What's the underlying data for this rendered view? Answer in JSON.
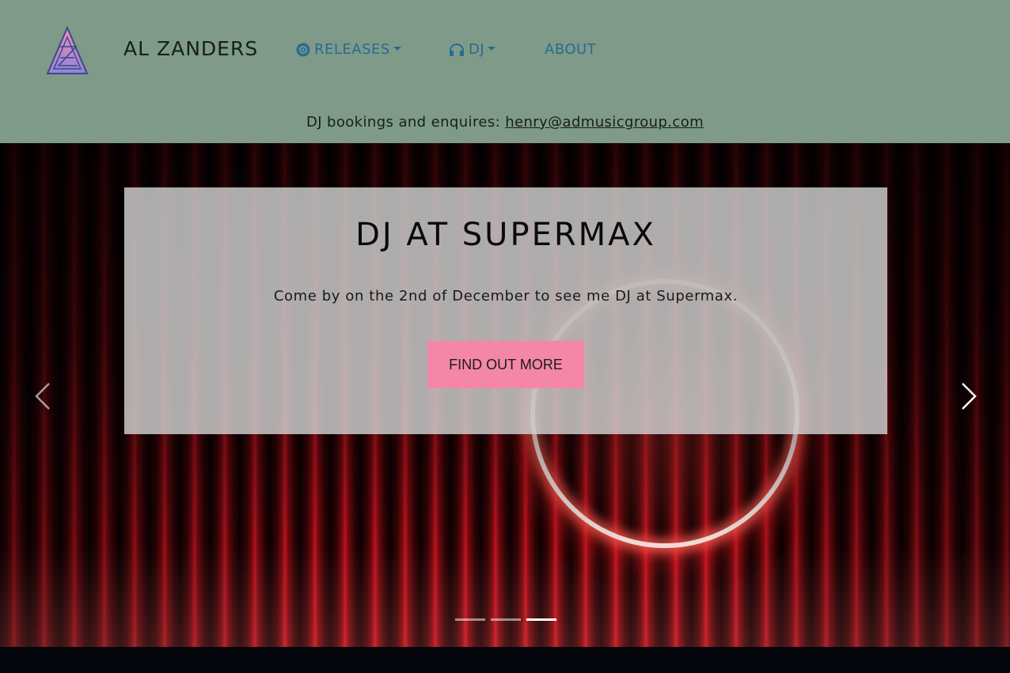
{
  "header": {
    "brand": "AL ZANDERS",
    "nav": {
      "releases": "RELEASES",
      "dj": "DJ",
      "about": "ABOUT"
    },
    "booking_text": "DJ bookings and enquires: ",
    "booking_email": "henry@admusicgroup.com"
  },
  "carousel": {
    "title": "DJ AT SUPERMAX",
    "text": "Come by on the 2nd of December to see me DJ at Supermax.",
    "button_label": "FIND OUT MORE",
    "indicator_count": 3,
    "active_index": 3
  },
  "colors": {
    "navbar_bg": "#7f9a89",
    "nav_link": "#276b91",
    "button_bg": "#f487a8",
    "caption_bg": "rgba(210,210,210,0.82)"
  },
  "icons": {
    "logo": "triangle-az-logo",
    "releases": "disc-icon",
    "dj": "headphones-icon",
    "prev": "chevron-left-icon",
    "next": "chevron-right-icon"
  }
}
